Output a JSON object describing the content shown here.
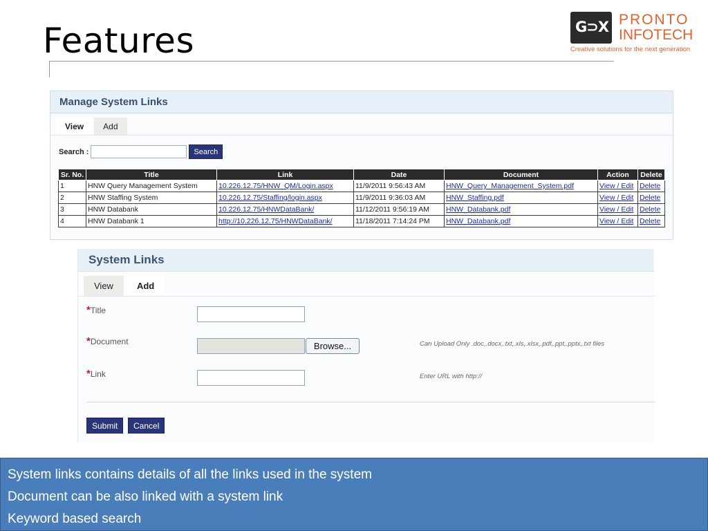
{
  "slide": {
    "title": "Features"
  },
  "logo": {
    "glyph": "G⊃X",
    "name_line1": "PRONTO",
    "name_line2": "INFOTECH",
    "tagline": "Creative solutions for the next generation",
    "accent_color": "#e0602f"
  },
  "manage_panel": {
    "heading": "Manage System Links",
    "tabs": [
      {
        "label": "View",
        "active": true
      },
      {
        "label": "Add",
        "active": false
      }
    ],
    "search": {
      "label": "Search :",
      "value": "",
      "button_label": "Search"
    },
    "table": {
      "columns": [
        "Sr. No.",
        "Title",
        "Link",
        "Date",
        "Document",
        "Action",
        "Delete"
      ],
      "rows": [
        {
          "sr": "1",
          "title": "HNW Query Management System",
          "link": "10.226.12.75/HNW_QM/Login.aspx",
          "date": "11/9/2011 9:56:43 AM",
          "document": "HNW_Query_Management_System.pdf",
          "action": "View / Edit",
          "delete": "Delete"
        },
        {
          "sr": "2",
          "title": "HNW Staffing System",
          "link": "10.226.12.75/Staffing/login.aspx",
          "date": "11/9/2011 9:36:03 AM",
          "document": "HNW_Staffing.pdf",
          "action": "View / Edit",
          "delete": "Delete"
        },
        {
          "sr": "3",
          "title": "HNW Databank",
          "link": "10.226.12.75/HNWDataBank/",
          "date": "11/12/2011 9:56:19 AM",
          "document": "HNW_Databank.pdf",
          "action": "View / Edit",
          "delete": "Delete"
        },
        {
          "sr": "4",
          "title": "HNW Databank 1",
          "link": "http://10.226.12.75/HNWDataBank/",
          "date": "11/18/2011 7:14:24 PM",
          "document": "HNW_Databank.pdf",
          "action": "View / Edit",
          "delete": "Delete"
        }
      ]
    }
  },
  "add_panel": {
    "heading": "System Links",
    "tabs": [
      {
        "label": "View",
        "active": false
      },
      {
        "label": "Add",
        "active": true
      }
    ],
    "fields": {
      "title": {
        "required_mark": "*",
        "label": "Title",
        "value": ""
      },
      "document": {
        "required_mark": "*",
        "label": "Document",
        "value": "",
        "browse_label": "Browse...",
        "hint": "Can Upload Only .doc,.docx,.txt,.xls,.xlsx,.pdf,.ppt,.pptx,.txt files"
      },
      "link": {
        "required_mark": "*",
        "label": "Link",
        "value": "",
        "hint": "Enter URL with http://"
      }
    },
    "submit_label": "Submit",
    "cancel_label": "Cancel"
  },
  "notes": [
    "System links contains details of all the links used in the system",
    "Document can be also linked with a system link",
    "Keyword based search"
  ],
  "colors": {
    "button_bg": "#2a3479",
    "table_header_bg": "#2b2b2b",
    "notes_bg": "#4a7ebb",
    "panel_header_text": "#3a4f6b",
    "required_mark": "#c0182a"
  }
}
